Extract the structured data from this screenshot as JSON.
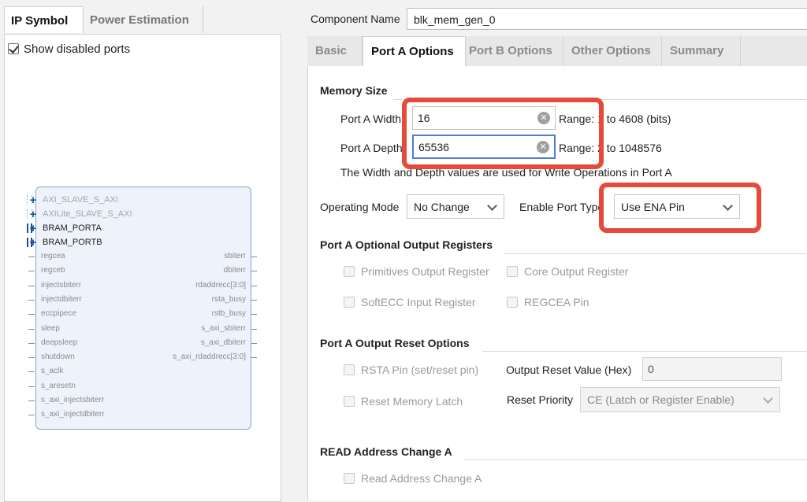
{
  "left_panel": {
    "tabs": [
      "IP Symbol",
      "Power Estimation"
    ],
    "show_disabled_label": "Show disabled ports",
    "show_disabled_checked": true,
    "bus_interfaces": [
      "AXI_SLAVE_S_AXI",
      "AXILite_SLAVE_S_AXI",
      "BRAM_PORTA",
      "BRAM_PORTB"
    ],
    "left_pins": [
      "regcea",
      "regceb",
      "injectsbiterr",
      "injectdbiterr",
      "eccpipece",
      "sleep",
      "deepsleep",
      "shutdown",
      "s_aclk",
      "s_aresetn",
      "s_axi_injectsbiterr",
      "s_axi_injectdbiterr"
    ],
    "right_pins": [
      "sbiterr",
      "dbiterr",
      "rdaddrecc[3:0]",
      "rsta_busy",
      "rstb_busy",
      "s_axi_sbiterr",
      "s_axi_dbiterr",
      "s_axi_rdaddrecc[3:0]"
    ]
  },
  "component": {
    "label": "Component Name",
    "value": "blk_mem_gen_0"
  },
  "tabs": [
    "Basic",
    "Port A Options",
    "Port B Options",
    "Other Options",
    "Summary"
  ],
  "active_tab": "Port A Options",
  "memory_size": {
    "title": "Memory Size",
    "width_label": "Port A Width",
    "width_value": "16",
    "width_range": "Range: 1 to 4608 (bits)",
    "depth_label": "Port A Depth",
    "depth_value": "65536",
    "depth_range": "Range: 2 to 1048576",
    "note": "The Width and Depth values are used for Write Operations in Port A"
  },
  "operating_mode": {
    "label": "Operating Mode",
    "value": "No Change"
  },
  "enable_port_type": {
    "label": "Enable Port Type",
    "value": "Use ENA Pin"
  },
  "optional_output_registers": {
    "title": "Port A Optional Output Registers",
    "options": [
      "Primitives Output Register",
      "Core Output Register",
      "SoftECC Input Register",
      "REGCEA Pin"
    ]
  },
  "output_reset": {
    "title": "Port A Output Reset Options",
    "rsta_pin": "RSTA Pin (set/reset pin)",
    "reset_value_label": "Output Reset Value (Hex)",
    "reset_value": "0",
    "reset_memory_latch": "Reset Memory Latch",
    "reset_priority_label": "Reset Priority",
    "reset_priority_value": "CE (Latch or Register Enable)"
  },
  "read_address_change": {
    "title": "READ Address Change A",
    "option": "Read Address Change A"
  },
  "colors": {
    "highlight": "#e64a3b",
    "accent": "#4f7bd0",
    "symbol_border": "#7aa6d8"
  },
  "icons": [
    "check-icon",
    "clear-icon",
    "chevron-down-icon",
    "plus-icon"
  ]
}
